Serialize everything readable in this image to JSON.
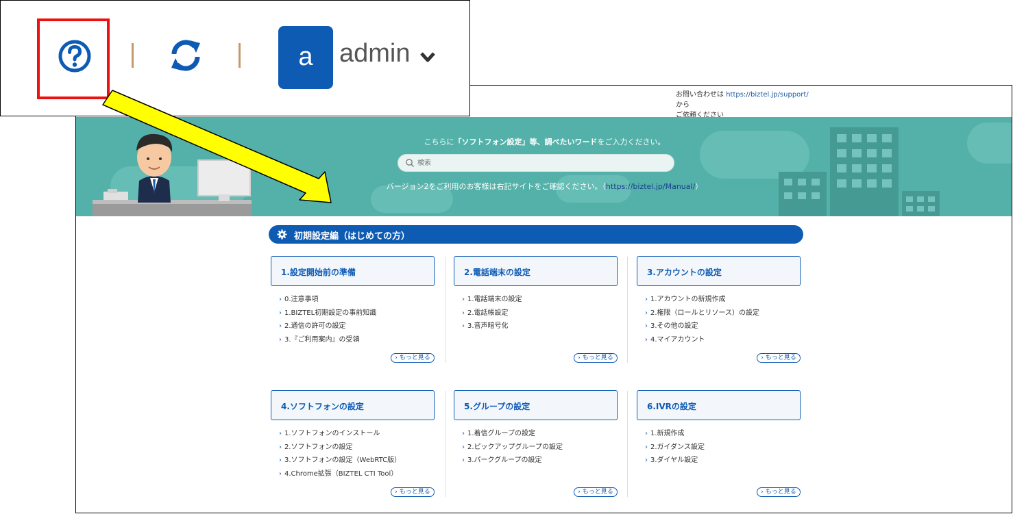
{
  "header": {
    "username": "admin",
    "avatar_letter": "a",
    "icons": [
      "help-icon",
      "refresh-icon",
      "chevron-down-icon"
    ]
  },
  "contact": {
    "prefix": "お問い合わせは ",
    "link": "https://biztel.jp/support/",
    "suffix": " から",
    "line2": "ご依頼ください"
  },
  "banner": {
    "prompt_before": "こちらに",
    "prompt_bold": "「ソフトフォン設定」等、調べたいワード",
    "prompt_after": "をご入力ください。",
    "search_placeholder": "検索",
    "version_text": "バージョン2をご利用のお客様は右記サイトをご確認ください。（",
    "version_link": "https://biztel.jp/Manual/",
    "version_close": "）"
  },
  "section": {
    "title": "初期設定編（はじめての方）"
  },
  "cards": [
    {
      "title": "1.設定開始前の準備",
      "items": [
        "0.注意事項",
        "1.BIZTEL初期設定の事前知識",
        "2.通信の許可の設定",
        "3.『ご利用案内』の受領"
      ],
      "more": "もっと見る"
    },
    {
      "title": "2.電話端末の設定",
      "items": [
        "1.電話端末の設定",
        "2.電話帳設定",
        "3.音声暗号化"
      ],
      "more": "もっと見る"
    },
    {
      "title": "3.アカウントの設定",
      "items": [
        "1.アカウントの新規作成",
        "2.権限（ロールとリソース）の設定",
        "3.その他の設定",
        "4.マイアカウント"
      ],
      "more": "もっと見る"
    },
    {
      "title": "4.ソフトフォンの設定",
      "items": [
        "1.ソフトフォンのインストール",
        "2.ソフトフォンの設定",
        "3.ソフトフォンの設定（WebRTC版）",
        "4.Chrome拡張（BIZTEL CTI Tool）"
      ],
      "more": "もっと見る"
    },
    {
      "title": "5.グループの設定",
      "items": [
        "1.着信グループの設定",
        "2.ピックアップグループの設定",
        "3.パークグループの設定"
      ],
      "more": "もっと見る"
    },
    {
      "title": "6.IVRの設定",
      "items": [
        "1.新規作成",
        "2.ガイダンス設定",
        "3.ダイヤル設定"
      ],
      "more": "もっと見る"
    }
  ],
  "colors": {
    "brand_blue": "#0e5bb4",
    "banner_teal": "#53b1a9",
    "highlight_red": "#ee1111",
    "arrow_yellow": "#ffff00"
  }
}
